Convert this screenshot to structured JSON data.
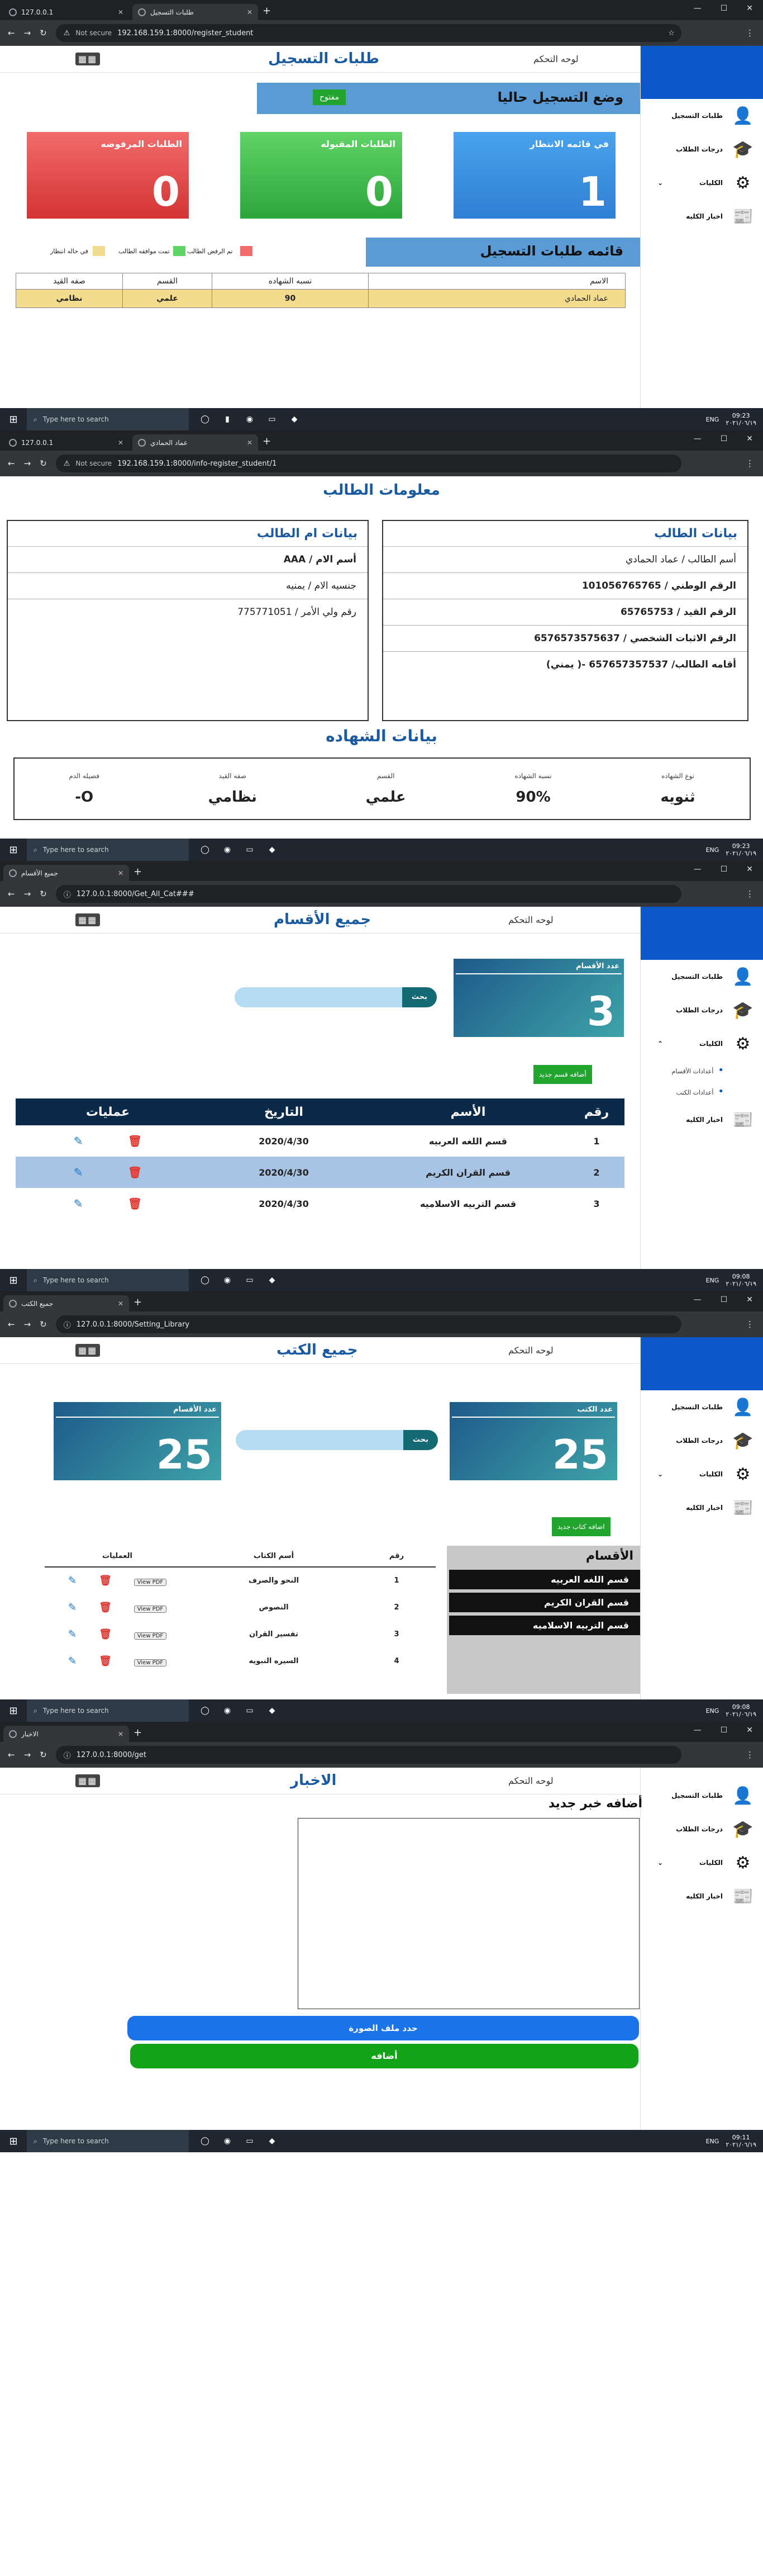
{
  "taskbar": {
    "search_placeholder": "Type here to search",
    "lang": "ENG"
  },
  "screens": {
    "s1": {
      "tabs": [
        "127.0.0.1",
        "طلبات التسجيل"
      ],
      "url_prefix": "Not secure",
      "url": "192.168.159.1:8000/register_student",
      "clock": [
        "09:23",
        "٢٠٢١/٠٦/١٩"
      ],
      "header": {
        "title": "طلبات التسجيل",
        "home": "لوحه التحكم"
      },
      "status_bar": {
        "label": "وضع التسجيل حاليا",
        "button": "مفتوح"
      },
      "cards": [
        {
          "label": "في قائمه الانتظار",
          "value": "1"
        },
        {
          "label": "الطلبات المقبوله",
          "value": "0"
        },
        {
          "label": "الطلبات المرفوضه",
          "value": "0"
        }
      ],
      "list_title": "قائمه طلبات التسجيل",
      "legend": [
        "تم الرفض الطالب",
        "تمت موافقه الطالب",
        "في حاله انتظار"
      ],
      "table": {
        "headers": [
          "الاسم",
          "نسبه الشهاده",
          "القسم",
          "صفه القيد"
        ],
        "rows": [
          [
            "عماد الحمادي",
            "90",
            "علمي",
            "نظامي"
          ]
        ]
      }
    },
    "s2": {
      "tabs": [
        "127.0.0.1",
        "عماد الحمادي"
      ],
      "url_prefix": "Not secure",
      "url": "192.168.159.1:8000/info-register_student/1",
      "clock": [
        "09:23",
        "٢٠٢١/٠٦/١٩"
      ],
      "page_title": "معلومات الطالب",
      "student": {
        "title": "بيانات الطالب",
        "rows": [
          "أسم الطالب /  عماد الحمادي",
          "الرقم الوطني / 101056765765",
          "الرقم القيد / 65765753",
          "الرقم الاثبات الشخصي / 6576573575637",
          "أقامه الطالب/ 657657357537 -( يمني)"
        ]
      },
      "mother": {
        "title": "بيانات ام الطالب",
        "rows": [
          "أسم الام / AAA",
          "جنسيه الام / يمنيه",
          "رقم ولي الأمر / 775771051"
        ]
      },
      "cert_title": "بيانات الشهاده",
      "cert": [
        {
          "label": "نوع الشهاده",
          "value": "ثنويه"
        },
        {
          "label": "نسبه الشهاده",
          "value": "90%"
        },
        {
          "label": "القسم",
          "value": "علمي"
        },
        {
          "label": "صفه القيد",
          "value": "نظامي"
        },
        {
          "label": "فصيله الدم",
          "value": "-O"
        }
      ]
    },
    "s3": {
      "tabs": [
        "جميع الأقسام"
      ],
      "url": "127.0.0.1:8000/Get_All_Cat###",
      "clock": [
        "09:08",
        "٢٠٢١/٠٦/١٩"
      ],
      "header": {
        "title": "جميع الأقسام",
        "home": "لوحه التحكم"
      },
      "count": {
        "label": "عدد الأقسام",
        "value": "3"
      },
      "search_button": "بحث",
      "add_button": "أضافه قسم جديد",
      "table": {
        "headers": [
          "رقم",
          "الأسم",
          "التاريخ",
          "عمليات"
        ],
        "rows": [
          [
            "1",
            "قسم اللغه العربيه",
            "2020/4/30"
          ],
          [
            "2",
            "قسم القران الكريم",
            "2020/4/30"
          ],
          [
            "3",
            "قسم التربيه الاسلاميه",
            "2020/4/30"
          ]
        ]
      }
    },
    "s4": {
      "tabs": [
        "جميع الكتب"
      ],
      "url": "127.0.0.1:8000/Setting_Library",
      "clock": [
        "09:08",
        "٢٠٢١/٠٦/١٩"
      ],
      "header": {
        "title": "جميع الكتب",
        "home": "لوحه التحكم"
      },
      "books_count": {
        "label": "عدد الكتب",
        "value": "25"
      },
      "cats_count": {
        "label": "عدد الأقسام",
        "value": "25"
      },
      "search_button": "بحث",
      "add_button": "اضافه كتاب جديد",
      "categories_title": "الأقسام",
      "categories": [
        "قسم اللغه العربيه",
        "قسم القران الكريم",
        "قسم التربيه الاسلاميه"
      ],
      "table": {
        "headers": [
          "رقم",
          "أسم الكتاب",
          "العمليات"
        ],
        "view_label": "View PDF",
        "rows": [
          [
            "1",
            "النحو والصرف"
          ],
          [
            "2",
            "النصوص"
          ],
          [
            "3",
            "تفسير القران"
          ],
          [
            "4",
            "السيره النبويه"
          ]
        ]
      }
    },
    "s5": {
      "tabs": [
        "الاخبار"
      ],
      "url": "127.0.0.1:8000/get",
      "clock": [
        "09:11",
        "٢٠٢١/٠٦/١٩"
      ],
      "header": {
        "title": "الاخبار",
        "home": "لوحه التحكم"
      },
      "form_title": "أضافه خبر جديد",
      "choose_image": "حدد ملف الصورة",
      "submit": "أضافه"
    }
  },
  "sidebar": {
    "items": [
      "طلبات التسجيل",
      "درجات الطلاب",
      "الكليات",
      "اخبار الكليه"
    ],
    "sub_items": [
      "أعدادات الأقسام",
      "أعدادات الكتب"
    ]
  },
  "colors": {
    "blue_card": "#2e8ee0",
    "green_card": "#33b24a",
    "red_card": "#e03a3a",
    "accent_bar": "#5b9bd5",
    "navy": "#0b2a4a",
    "teal_grad": "#1e5a8a",
    "green_btn": "#22a52e"
  }
}
